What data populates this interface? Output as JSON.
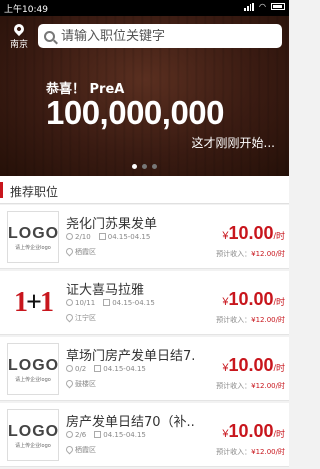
{
  "status_bar": {
    "time": "上午10:49"
  },
  "header": {
    "city": "南京",
    "search_placeholder": "请输入职位关键字"
  },
  "banner": {
    "congrats": "恭喜！ PreA",
    "amount": "100,000,000",
    "subtitle": "这才刚刚开始...",
    "dots": 3,
    "active_dot": 0
  },
  "section": {
    "title": "推荐职位"
  },
  "jobs": [
    {
      "title": "尧化门苏果发单",
      "logo": "LOGO",
      "logo_sub": "请上传企业logo",
      "count": "2/10",
      "date": "04.15-04.15",
      "district": "栖霞区",
      "currency": "¥",
      "pay": "10.00",
      "unit": "/时",
      "est_label": "预计收入：",
      "est_value": "¥12.00/时"
    },
    {
      "title": "证大喜马拉雅",
      "logo": "1+1",
      "logo_sub": "",
      "count": "10/11",
      "date": "04.15-04.15",
      "district": "江宁区",
      "currency": "¥",
      "pay": "10.00",
      "unit": "/时",
      "est_label": "预计收入：",
      "est_value": "¥12.00/时"
    },
    {
      "title": "草场门房产发单日结7...",
      "logo": "LOGO",
      "logo_sub": "请上传企业logo",
      "count": "0/2",
      "date": "04.15-04.15",
      "district": "鼓楼区",
      "currency": "¥",
      "pay": "10.00",
      "unit": "/时",
      "est_label": "预计收入：",
      "est_value": "¥12.00/时"
    },
    {
      "title": "房产发单日结70（补...",
      "logo": "LOGO",
      "logo_sub": "请上传企业logo",
      "count": "2/6",
      "date": "04.15-04.15",
      "district": "栖霞区",
      "currency": "¥",
      "pay": "10.00",
      "unit": "/时",
      "est_label": "预计收入：",
      "est_value": "¥12.00/时"
    }
  ]
}
